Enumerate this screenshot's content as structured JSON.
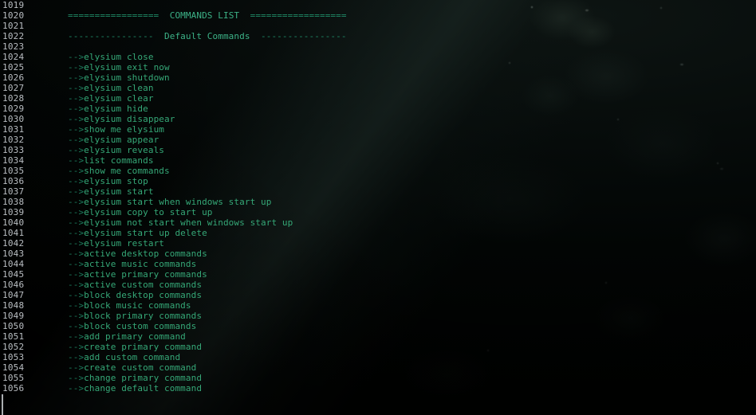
{
  "terminal": {
    "first_line_number": 1019,
    "banner": {
      "left_rule": "=================",
      "title": "COMMANDS LIST",
      "right_rule": "=================="
    },
    "section": {
      "left_rule": "----------------",
      "title": "Default Commands",
      "right_rule": "----------------"
    },
    "prefix": "-->",
    "colors": {
      "command_text": "#35a877",
      "prefix": "#1c7b5c",
      "rule": "#1f8a66",
      "title": "#3cb287",
      "line_number": "#b9bec2",
      "background": "#010302"
    },
    "lines": [
      {
        "number": 1019,
        "type": "blank",
        "text": ""
      },
      {
        "number": 1020,
        "type": "banner",
        "text": ""
      },
      {
        "number": 1021,
        "type": "blank",
        "text": ""
      },
      {
        "number": 1022,
        "type": "section",
        "text": ""
      },
      {
        "number": 1023,
        "type": "blank",
        "text": ""
      },
      {
        "number": 1024,
        "type": "command",
        "text": "elysium close"
      },
      {
        "number": 1025,
        "type": "command",
        "text": "elysium exit now"
      },
      {
        "number": 1026,
        "type": "command",
        "text": "elysium shutdown"
      },
      {
        "number": 1027,
        "type": "command",
        "text": "elysium clean"
      },
      {
        "number": 1028,
        "type": "command",
        "text": "elysium clear"
      },
      {
        "number": 1029,
        "type": "command",
        "text": "elysium hide"
      },
      {
        "number": 1030,
        "type": "command",
        "text": "elysium disappear"
      },
      {
        "number": 1031,
        "type": "command",
        "text": "show me elysium"
      },
      {
        "number": 1032,
        "type": "command",
        "text": "elysium appear"
      },
      {
        "number": 1033,
        "type": "command",
        "text": "elysium reveals"
      },
      {
        "number": 1034,
        "type": "command",
        "text": "list commands"
      },
      {
        "number": 1035,
        "type": "command",
        "text": "show me commands"
      },
      {
        "number": 1036,
        "type": "command",
        "text": "elysium stop"
      },
      {
        "number": 1037,
        "type": "command",
        "text": "elysium start"
      },
      {
        "number": 1038,
        "type": "command",
        "text": "elysium start when windows start up"
      },
      {
        "number": 1039,
        "type": "command",
        "text": "elysium copy to start up"
      },
      {
        "number": 1040,
        "type": "command",
        "text": "elysium not start when windows start up"
      },
      {
        "number": 1041,
        "type": "command",
        "text": "elysium start up delete"
      },
      {
        "number": 1042,
        "type": "command",
        "text": "elysium restart"
      },
      {
        "number": 1043,
        "type": "command",
        "text": "active desktop commands"
      },
      {
        "number": 1044,
        "type": "command",
        "text": "active music commands"
      },
      {
        "number": 1045,
        "type": "command",
        "text": "active primary commands"
      },
      {
        "number": 1046,
        "type": "command",
        "text": "active custom commands"
      },
      {
        "number": 1047,
        "type": "command",
        "text": "block desktop commands"
      },
      {
        "number": 1048,
        "type": "command",
        "text": "block music commands"
      },
      {
        "number": 1049,
        "type": "command",
        "text": "block primary commands"
      },
      {
        "number": 1050,
        "type": "command",
        "text": "block custom commands"
      },
      {
        "number": 1051,
        "type": "command",
        "text": "add primary command"
      },
      {
        "number": 1052,
        "type": "command",
        "text": "create primary command"
      },
      {
        "number": 1053,
        "type": "command",
        "text": "add custom command"
      },
      {
        "number": 1054,
        "type": "command",
        "text": "create custom command"
      },
      {
        "number": 1055,
        "type": "command",
        "text": "change primary command"
      },
      {
        "number": 1056,
        "type": "command",
        "text": "change default command"
      }
    ]
  }
}
